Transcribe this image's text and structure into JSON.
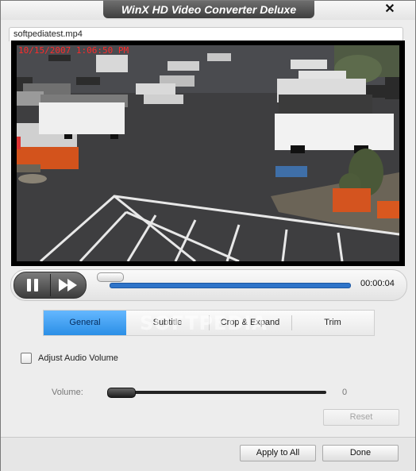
{
  "window": {
    "title": "WinX HD Video Converter Deluxe",
    "close_symbol": "✕"
  },
  "file": {
    "name": "softpediatest.mp4"
  },
  "video": {
    "timestamp_overlay": "10/15/2007 1:06:50 PM"
  },
  "player": {
    "elapsed": "00:00:04",
    "progress": 0.0
  },
  "tabs": [
    {
      "label": "General",
      "active": true
    },
    {
      "label": "Subtitle",
      "active": false
    },
    {
      "label": "Crop & Expand",
      "active": false
    },
    {
      "label": "Trim",
      "active": false
    }
  ],
  "watermark": "SOFTPEDIA",
  "audio": {
    "checkbox_label": "Adjust Audio Volume",
    "checked": false,
    "volume_label": "Volume:",
    "volume_value": "0",
    "reset_label": "Reset"
  },
  "footer": {
    "apply_all_label": "Apply to All",
    "done_label": "Done"
  },
  "colors": {
    "accent": "#2b8fe6",
    "title_bg": "#4a4a4a",
    "progress": "#2f74c9"
  }
}
